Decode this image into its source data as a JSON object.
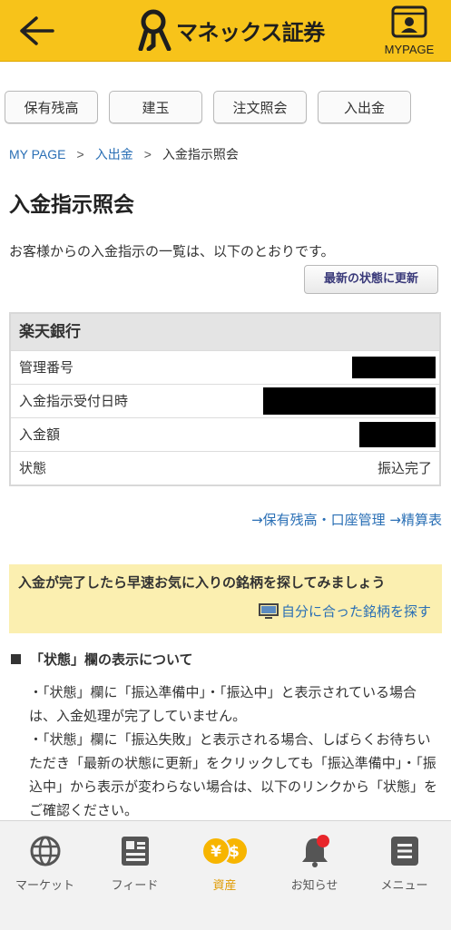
{
  "header": {
    "logo_text": "マネックス証券",
    "mypage_label": "MYPAGE",
    "back_icon": "back-arrow-icon",
    "mypage_icon": "user-card-icon",
    "color": "#f7c31a"
  },
  "tabs": [
    {
      "label": "保有残高"
    },
    {
      "label": "建玉"
    },
    {
      "label": "注文照会"
    },
    {
      "label": "入出金"
    }
  ],
  "breadcrumb": {
    "items": [
      "MY PAGE",
      "入出金",
      "入金指示照会"
    ],
    "separator": ">"
  },
  "page_title": "入金指示照会",
  "intro_text": "お客様からの入金指示の一覧は、以下のとおりです。",
  "refresh_button": "最新の状態に更新",
  "detail": {
    "bank": "楽天銀行",
    "rows": [
      {
        "label": "管理番号",
        "value": ""
      },
      {
        "label": "入金指示受付日時",
        "value": ""
      },
      {
        "label": "入金額",
        "value": ""
      },
      {
        "label": "状態",
        "value": "振込完了"
      }
    ]
  },
  "links": {
    "holdings": "→保有残高・口座管理",
    "statement": "→精算表"
  },
  "banner": {
    "text": "入金が完了したら早速お気に入りの銘柄を探してみましょう",
    "link": "自分に合った銘柄を探す",
    "link_icon": "monitor-icon"
  },
  "section": {
    "title": "「状態」欄の表示について",
    "notes": [
      "・「状態」欄に「振込準備中」・「振込中」と表示されている場合は、入金処理が完了していません。",
      "・「状態」欄に「振込失敗」と表示される場合、しばらくお待ちいただき「最新の状態に更新」をクリックしても「振込準備中」・「振込中」から表示が変わらない場合は、以下のリンクから「状態」をご確認ください。"
    ]
  },
  "bottom_nav": [
    {
      "label": "マーケット",
      "icon": "globe-icon"
    },
    {
      "label": "フィード",
      "icon": "news-icon"
    },
    {
      "label": "資産",
      "icon": "yen-dollar-coins-icon",
      "active": true
    },
    {
      "label": "お知らせ",
      "icon": "bell-icon",
      "badge": true
    },
    {
      "label": "メニュー",
      "icon": "menu-icon"
    }
  ],
  "colors": {
    "accent": "#f7c31a",
    "link": "#2a6fb5",
    "banner_bg": "#fbefb0",
    "active_nav": "#e09a00",
    "badge": "#e8262b"
  }
}
